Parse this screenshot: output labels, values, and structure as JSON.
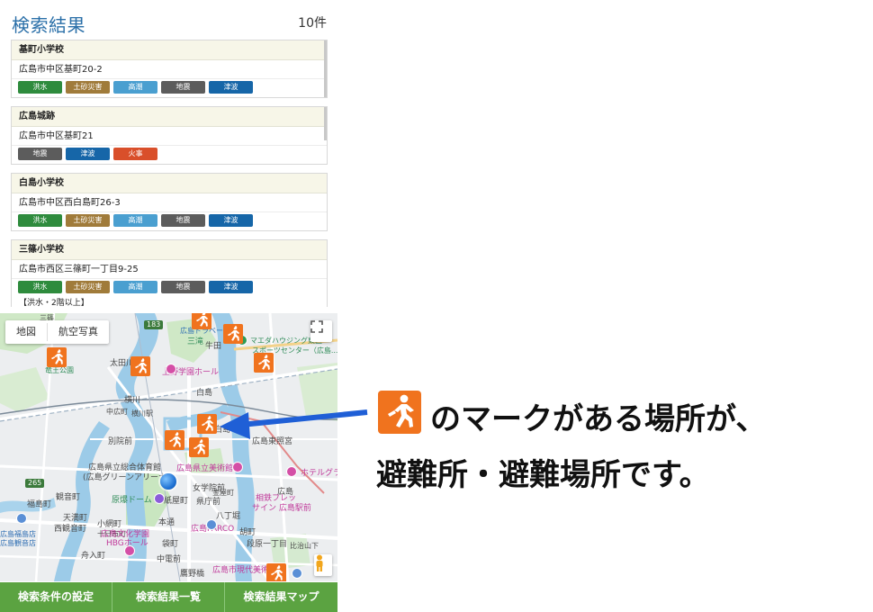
{
  "results": {
    "title": "検索結果",
    "count": "10件",
    "items": [
      {
        "name": "基町小学校",
        "address": "広島市中区基町20-2",
        "tags": [
          "洪水",
          "土砂災害",
          "高潮",
          "地震",
          "津波"
        ]
      },
      {
        "name": "広島城跡",
        "address": "広島市中区基町21",
        "tags": [
          "地震",
          "津波",
          "火事"
        ]
      },
      {
        "name": "白島小学校",
        "address": "広島市中区西白島町26-3",
        "tags": [
          "洪水",
          "土砂災害",
          "高潮",
          "地震",
          "津波"
        ]
      },
      {
        "name": "三篠小学校",
        "address": "広島市西区三篠町一丁目9-25",
        "tags": [
          "洪水",
          "土砂災害",
          "高潮",
          "地震",
          "津波"
        ]
      }
    ],
    "partial_line": "【洪水・2階以上】"
  },
  "tag_colors": {
    "洪水": "#2e8b3d",
    "土砂災害": "#a07b3a",
    "高潮": "#4a9fd0",
    "地震": "#5c5c5c",
    "津波": "#1666a8",
    "火事": "#d94f2a"
  },
  "map": {
    "type_buttons": [
      "地図",
      "航空写真"
    ],
    "fullscreen_icon": "fullscreen-icon",
    "pegman_icon": "pegman-icon",
    "marker_icon": "evacuation-running-person-icon",
    "labels": {
      "hiroshima_dorm": "広島ドラベース",
      "mitaki": "三篠",
      "mitaki2": "三滝",
      "ushita": "牛田",
      "mazda": "マエダハウジング東区",
      "sports": "スポーツセンター（広島...",
      "ryuo": "竜王公園",
      "ota": "太田川",
      "ueno": "上野学園ホール",
      "hakushima": "白島",
      "yokogawa": "横川",
      "yokogawa_ekimae": "横川駅",
      "nakahiro": "中広町",
      "hiroshima_station": "新白島",
      "hakushima2": "白島",
      "betsuin": "別院前",
      "gym": "広島県立総合体育館",
      "gym2": "(広島グリーンアリーナ)",
      "museum": "広島県立美術館",
      "toshogu": "広島東照宮",
      "hotel": "ホテルグラ",
      "jogakuin": "女学院前",
      "hiroshima_dome": "原爆ドーム",
      "kamiyacho": "紙屋町",
      "kencho": "県庁前",
      "fukushima": "福島町",
      "kannon": "観音町",
      "tenma": "天満町",
      "koami": "小網町",
      "nishikannon": "西観音町",
      "tokaichi": "十日市町",
      "hondori": "本通",
      "parco": "広島PARCO",
      "hatchobori": "八丁堀",
      "hiroshima_pref": "広島",
      "sogo": "相鉄フレッ",
      "sign": "サイン 広島駅前",
      "danbara": "段原一丁目",
      "hbg": "広島文化学園",
      "hbg2": "HBGホール",
      "funairi": "舟入町",
      "nakaden": "中電前",
      "fukuro": "袋町",
      "takanobashi": "鷹野橋",
      "ebisu": "胡町",
      "city_museum": "広島市現代美術館",
      "fukushima2": "広島福島店",
      "kannon2": "広島観音店",
      "route_265": "265",
      "route_183": "183",
      "kanaya": "金屋町",
      "hijiyama": "比治山下"
    }
  },
  "bottom_tabs": [
    "検索条件の設定",
    "検索結果一覧",
    "検索結果マップ"
  ],
  "annotation": {
    "line1": "のマークがある場所が、",
    "line2": "避難所・避難場所です。",
    "arrow_color": "#1f5fd6",
    "icon_color": "#f0731e"
  }
}
